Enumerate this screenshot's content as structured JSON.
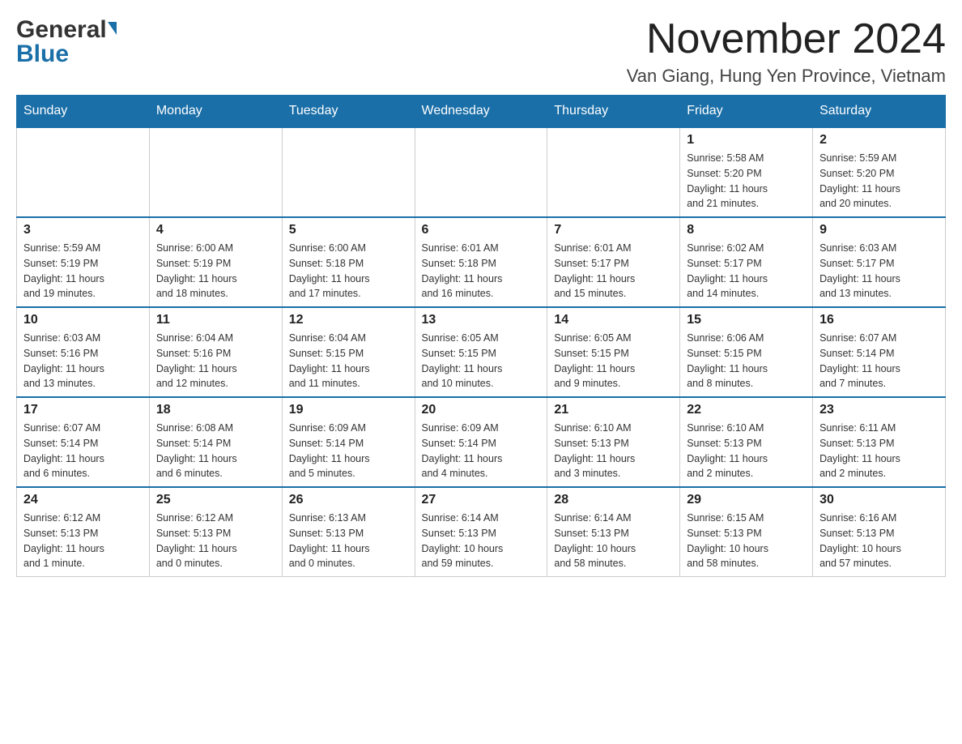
{
  "header": {
    "logo_general": "General",
    "logo_blue": "Blue",
    "month_title": "November 2024",
    "location": "Van Giang, Hung Yen Province, Vietnam"
  },
  "days_of_week": [
    "Sunday",
    "Monday",
    "Tuesday",
    "Wednesday",
    "Thursday",
    "Friday",
    "Saturday"
  ],
  "weeks": [
    [
      {
        "day": "",
        "info": ""
      },
      {
        "day": "",
        "info": ""
      },
      {
        "day": "",
        "info": ""
      },
      {
        "day": "",
        "info": ""
      },
      {
        "day": "",
        "info": ""
      },
      {
        "day": "1",
        "info": "Sunrise: 5:58 AM\nSunset: 5:20 PM\nDaylight: 11 hours\nand 21 minutes."
      },
      {
        "day": "2",
        "info": "Sunrise: 5:59 AM\nSunset: 5:20 PM\nDaylight: 11 hours\nand 20 minutes."
      }
    ],
    [
      {
        "day": "3",
        "info": "Sunrise: 5:59 AM\nSunset: 5:19 PM\nDaylight: 11 hours\nand 19 minutes."
      },
      {
        "day": "4",
        "info": "Sunrise: 6:00 AM\nSunset: 5:19 PM\nDaylight: 11 hours\nand 18 minutes."
      },
      {
        "day": "5",
        "info": "Sunrise: 6:00 AM\nSunset: 5:18 PM\nDaylight: 11 hours\nand 17 minutes."
      },
      {
        "day": "6",
        "info": "Sunrise: 6:01 AM\nSunset: 5:18 PM\nDaylight: 11 hours\nand 16 minutes."
      },
      {
        "day": "7",
        "info": "Sunrise: 6:01 AM\nSunset: 5:17 PM\nDaylight: 11 hours\nand 15 minutes."
      },
      {
        "day": "8",
        "info": "Sunrise: 6:02 AM\nSunset: 5:17 PM\nDaylight: 11 hours\nand 14 minutes."
      },
      {
        "day": "9",
        "info": "Sunrise: 6:03 AM\nSunset: 5:17 PM\nDaylight: 11 hours\nand 13 minutes."
      }
    ],
    [
      {
        "day": "10",
        "info": "Sunrise: 6:03 AM\nSunset: 5:16 PM\nDaylight: 11 hours\nand 13 minutes."
      },
      {
        "day": "11",
        "info": "Sunrise: 6:04 AM\nSunset: 5:16 PM\nDaylight: 11 hours\nand 12 minutes."
      },
      {
        "day": "12",
        "info": "Sunrise: 6:04 AM\nSunset: 5:15 PM\nDaylight: 11 hours\nand 11 minutes."
      },
      {
        "day": "13",
        "info": "Sunrise: 6:05 AM\nSunset: 5:15 PM\nDaylight: 11 hours\nand 10 minutes."
      },
      {
        "day": "14",
        "info": "Sunrise: 6:05 AM\nSunset: 5:15 PM\nDaylight: 11 hours\nand 9 minutes."
      },
      {
        "day": "15",
        "info": "Sunrise: 6:06 AM\nSunset: 5:15 PM\nDaylight: 11 hours\nand 8 minutes."
      },
      {
        "day": "16",
        "info": "Sunrise: 6:07 AM\nSunset: 5:14 PM\nDaylight: 11 hours\nand 7 minutes."
      }
    ],
    [
      {
        "day": "17",
        "info": "Sunrise: 6:07 AM\nSunset: 5:14 PM\nDaylight: 11 hours\nand 6 minutes."
      },
      {
        "day": "18",
        "info": "Sunrise: 6:08 AM\nSunset: 5:14 PM\nDaylight: 11 hours\nand 6 minutes."
      },
      {
        "day": "19",
        "info": "Sunrise: 6:09 AM\nSunset: 5:14 PM\nDaylight: 11 hours\nand 5 minutes."
      },
      {
        "day": "20",
        "info": "Sunrise: 6:09 AM\nSunset: 5:14 PM\nDaylight: 11 hours\nand 4 minutes."
      },
      {
        "day": "21",
        "info": "Sunrise: 6:10 AM\nSunset: 5:13 PM\nDaylight: 11 hours\nand 3 minutes."
      },
      {
        "day": "22",
        "info": "Sunrise: 6:10 AM\nSunset: 5:13 PM\nDaylight: 11 hours\nand 2 minutes."
      },
      {
        "day": "23",
        "info": "Sunrise: 6:11 AM\nSunset: 5:13 PM\nDaylight: 11 hours\nand 2 minutes."
      }
    ],
    [
      {
        "day": "24",
        "info": "Sunrise: 6:12 AM\nSunset: 5:13 PM\nDaylight: 11 hours\nand 1 minute."
      },
      {
        "day": "25",
        "info": "Sunrise: 6:12 AM\nSunset: 5:13 PM\nDaylight: 11 hours\nand 0 minutes."
      },
      {
        "day": "26",
        "info": "Sunrise: 6:13 AM\nSunset: 5:13 PM\nDaylight: 11 hours\nand 0 minutes."
      },
      {
        "day": "27",
        "info": "Sunrise: 6:14 AM\nSunset: 5:13 PM\nDaylight: 10 hours\nand 59 minutes."
      },
      {
        "day": "28",
        "info": "Sunrise: 6:14 AM\nSunset: 5:13 PM\nDaylight: 10 hours\nand 58 minutes."
      },
      {
        "day": "29",
        "info": "Sunrise: 6:15 AM\nSunset: 5:13 PM\nDaylight: 10 hours\nand 58 minutes."
      },
      {
        "day": "30",
        "info": "Sunrise: 6:16 AM\nSunset: 5:13 PM\nDaylight: 10 hours\nand 57 minutes."
      }
    ]
  ]
}
